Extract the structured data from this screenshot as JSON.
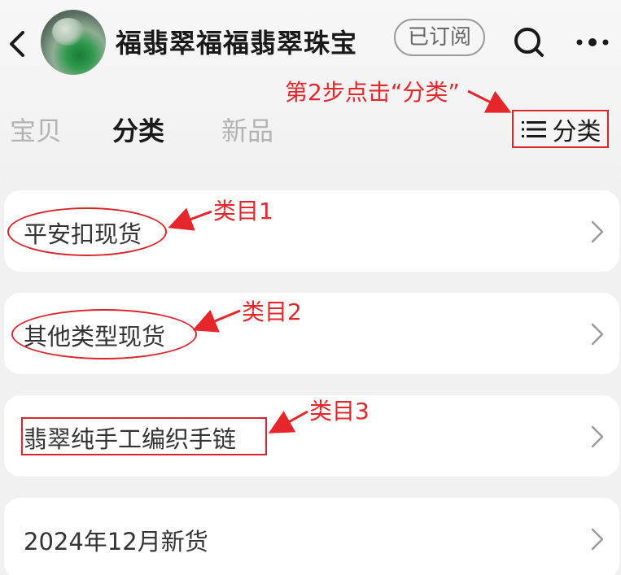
{
  "header": {
    "shop_name": "福翡翠福福翡翠珠宝",
    "subscribe_label": "已订阅"
  },
  "tabs": [
    {
      "label": "宝贝",
      "active": false
    },
    {
      "label": "分类",
      "active": true
    },
    {
      "label": "新品",
      "active": false
    }
  ],
  "category_button": {
    "label": "分类",
    "icon": "list-icon"
  },
  "categories": [
    {
      "label": "平安扣现货"
    },
    {
      "label": "其他类型现货"
    },
    {
      "label": "翡翠纯手工编织手链"
    },
    {
      "label": "2024年12月新货"
    }
  ],
  "annotations": {
    "step": "第2步点击“分类”",
    "cat1": "类目1",
    "cat2": "类目2",
    "cat3": "类目3",
    "color": "#e5262b"
  },
  "icons": [
    "back-icon",
    "shop-avatar",
    "search-icon",
    "more-icon",
    "chevron-right-icon"
  ]
}
